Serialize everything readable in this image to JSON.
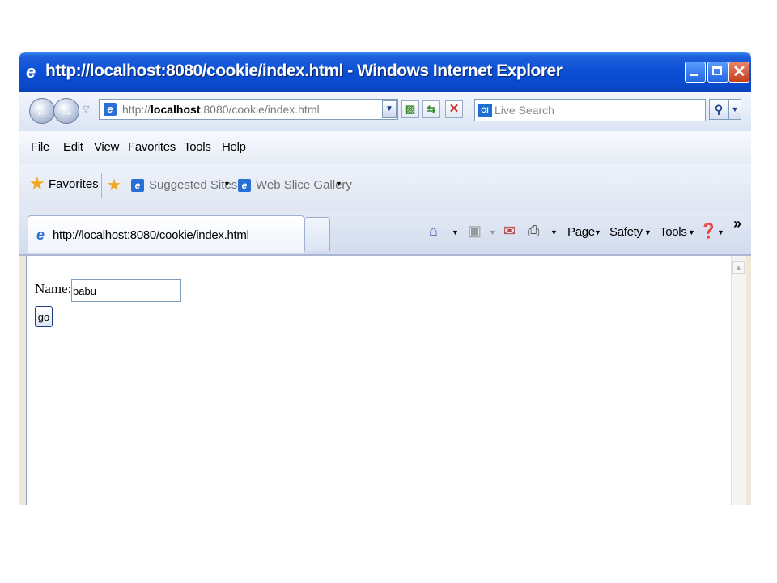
{
  "window": {
    "title": "http://localhost:8080/cookie/index.html - Windows Internet Explorer"
  },
  "address_bar": {
    "url_prefix": "http://",
    "url_host": "localhost",
    "url_rest": ":8080/cookie/index.html"
  },
  "search": {
    "placeholder": "Live Search"
  },
  "menu": [
    "File",
    "Edit",
    "View",
    "Favorites",
    "Tools",
    "Help"
  ],
  "favorites_bar": {
    "favorites_label": "Favorites",
    "links": [
      "Suggested Sites",
      "Web Slice Gallery"
    ]
  },
  "tab": {
    "label": "http://localhost:8080/cookie/index.html"
  },
  "command_bar": {
    "page": "Page",
    "safety": "Safety",
    "tools": "Tools"
  },
  "form": {
    "name_label": "Name:",
    "name_value": "babu",
    "go_label": "go"
  }
}
